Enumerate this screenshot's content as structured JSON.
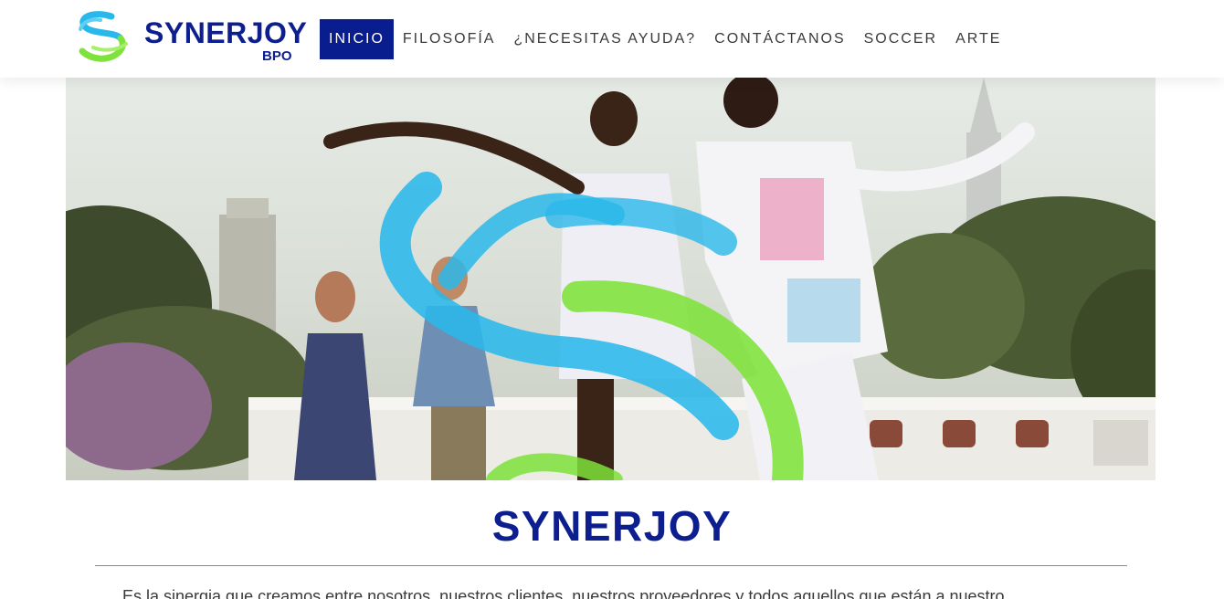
{
  "brand": {
    "name": "SYNERJOY",
    "sub": "BPO",
    "colors": {
      "navy": "#0d1f8f",
      "cyan": "#2ab8ea",
      "green": "#7ee23a"
    }
  },
  "nav": {
    "items": [
      {
        "label": "INICIO",
        "active": true
      },
      {
        "label": "FILOSOFÍA",
        "active": false
      },
      {
        "label": "¿NECESITAS AYUDA?",
        "active": false
      },
      {
        "label": "CONTÁCTANOS",
        "active": false
      },
      {
        "label": "SOCCER",
        "active": false
      },
      {
        "label": "ARTE",
        "active": false
      }
    ]
  },
  "hero": {
    "image": "salsa-dancers-photo"
  },
  "main": {
    "title": "SYNERJOY",
    "intro": "Es la sinergia que creamos entre nosotros, nuestros clientes, nuestros proveedores y todos aquellos que están a nuestro"
  }
}
